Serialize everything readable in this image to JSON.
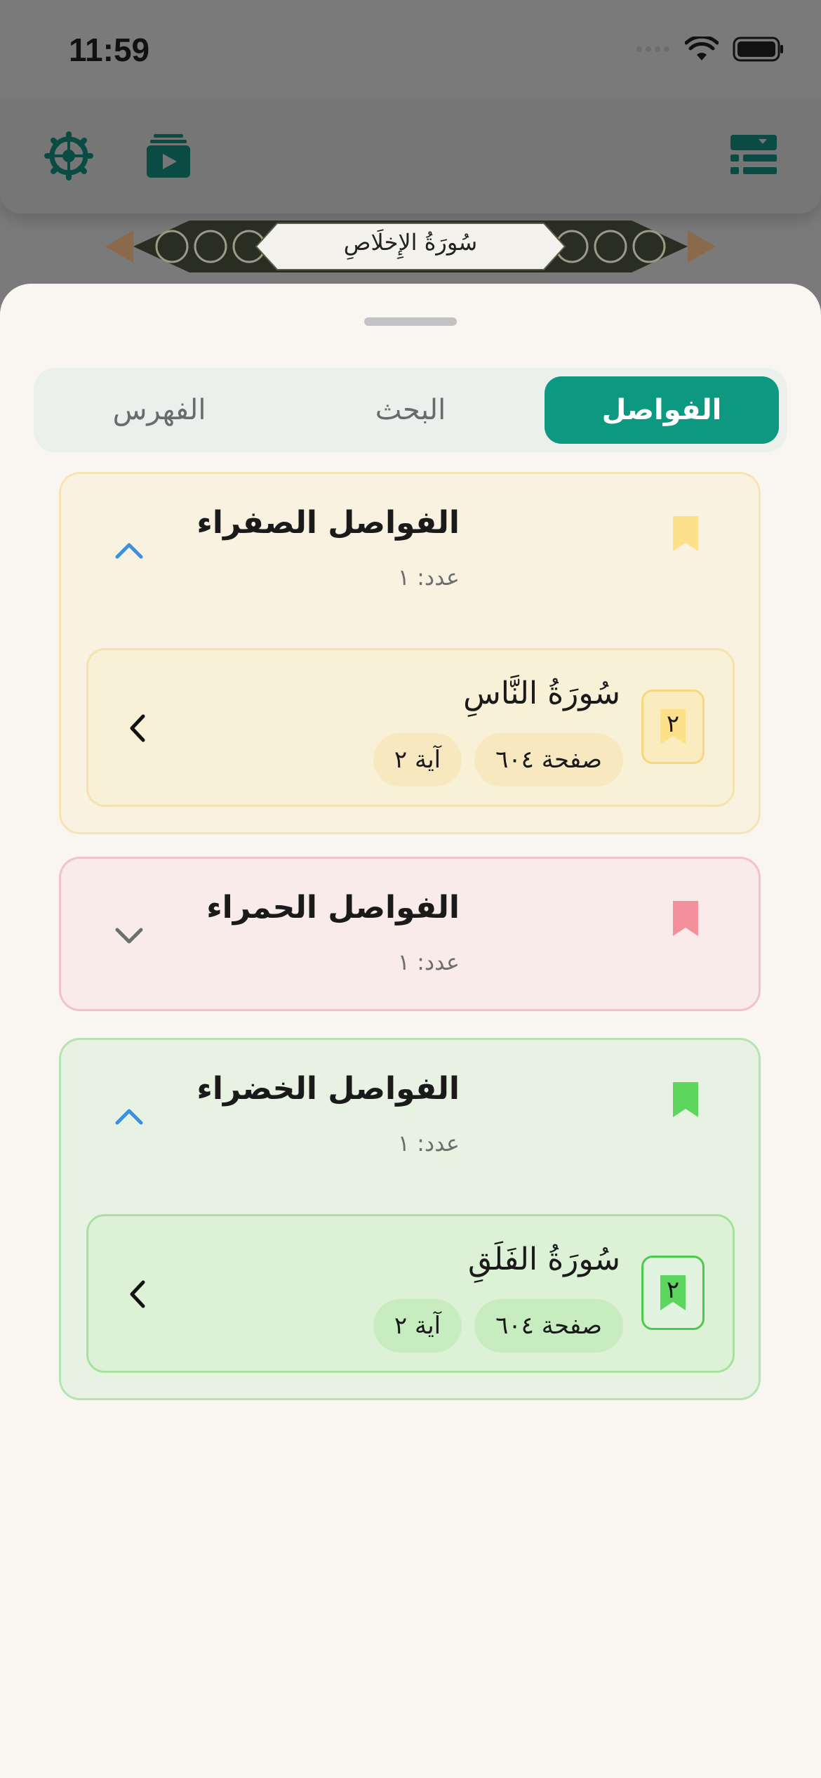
{
  "status_bar": {
    "time": "11:59"
  },
  "surah_banner": {
    "title": "سُورَةُ الإِخلَاصِ"
  },
  "tabs": [
    {
      "label": "الفواصل",
      "active": true
    },
    {
      "label": "البحث",
      "active": false
    },
    {
      "label": "الفهرس",
      "active": false
    }
  ],
  "groups": {
    "yellow": {
      "title": "الفواصل الصفراء",
      "count": "عدد: ١",
      "color": "#fde08a",
      "expanded": true
    },
    "red": {
      "title": "الفواصل الحمراء",
      "count": "عدد: ١",
      "color": "#f4909c",
      "expanded": false
    },
    "green": {
      "title": "الفواصل الخضراء",
      "count": "عدد: ١",
      "color": "#5cd65c",
      "expanded": true
    }
  },
  "bookmarks": {
    "yellow": {
      "badge": "٢",
      "surah": "سُورَةُ النَّاسِ",
      "page": "صفحة ٦٠٤",
      "ayah": "آية ٢"
    },
    "green": {
      "badge": "٢",
      "surah": "سُورَةُ الفَلَقِ",
      "page": "صفحة ٦٠٤",
      "ayah": "آية ٢"
    }
  },
  "colors": {
    "accent": "#0d9882",
    "chevron_expanded": "#3a8fe0",
    "chevron_collapsed": "#6e6e6e"
  },
  "icons": [
    "settings-icon",
    "play-icon",
    "index-menu-icon",
    "bookmark-icon",
    "chevron-up-icon",
    "chevron-down-icon",
    "chevron-left-icon"
  ]
}
